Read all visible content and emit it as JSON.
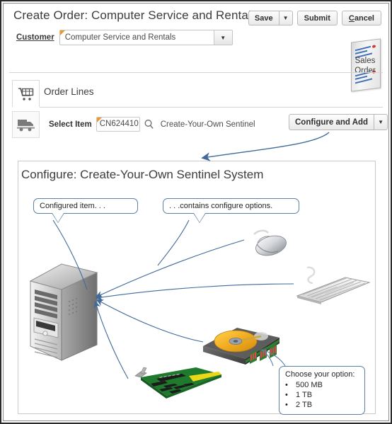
{
  "header": {
    "title": "Create Order: Computer Service and Rentals",
    "buttons": {
      "save": "Save",
      "save_menu_icon": "chevron-down-icon",
      "submit": "Submit",
      "cancel_prefix": "C",
      "cancel_rest": "ancel"
    },
    "customer": {
      "label": "Customer",
      "value": "Computer Service and Rentals",
      "dropdown_icon": "chevron-down-icon",
      "required": true
    },
    "sales_order_badge": {
      "line1": "Sales",
      "line2": "Order",
      "icon": "sales-order-document-icon"
    }
  },
  "order_lines": {
    "tab_label": "Order Lines",
    "tab_icon": "shopping-cart-icon",
    "fulfillment_icon": "truck-icon",
    "select_item": {
      "label": "Select Item",
      "value": "CN624410",
      "search_icon": "magnifier-icon",
      "description": "Create-Your-Own Sentinel",
      "required": true
    },
    "configure_button": {
      "label": "Configure and Add",
      "menu_icon": "chevron-down-icon"
    }
  },
  "configure_panel": {
    "title": "Configure: Create-Your-Own Sentinel System",
    "callouts": [
      {
        "id": "configured-item",
        "text": "Configured  item. . ."
      },
      {
        "id": "contains-options",
        "text": ". . .contains configure  options."
      }
    ],
    "options_callout": {
      "heading": "Choose your option:",
      "bullet": "•",
      "items": [
        "500 MB",
        "1 TB",
        "2 TB"
      ]
    },
    "hardware": [
      {
        "id": "computer-tower",
        "name": "computer-tower-image"
      },
      {
        "id": "mouse",
        "name": "computer-mouse-image"
      },
      {
        "id": "keyboard",
        "name": "keyboard-image"
      },
      {
        "id": "hard-drive",
        "name": "hard-drive-image"
      },
      {
        "id": "expansion-card",
        "name": "memory-expansion-card-image"
      }
    ]
  },
  "colors": {
    "accent_blue": "#5b7fa6",
    "required_orange": "#f0962e",
    "text": "#3c3c3c",
    "border": "#c9c9c9"
  }
}
